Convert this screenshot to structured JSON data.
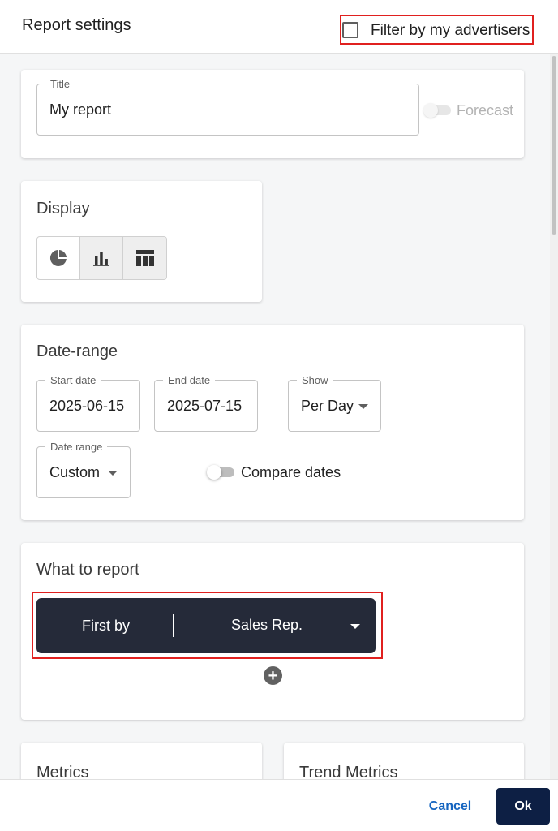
{
  "header": {
    "title": "Report settings",
    "filter_label": "Filter by my advertisers",
    "filter_checked": false
  },
  "title_card": {
    "title_label": "Title",
    "title_value": "My report",
    "forecast_label": "Forecast"
  },
  "display_card": {
    "heading": "Display",
    "options": [
      {
        "icon": "pie-chart-icon",
        "selected": false
      },
      {
        "icon": "bar-chart-icon",
        "selected": true
      },
      {
        "icon": "table-icon",
        "selected": true
      }
    ]
  },
  "date_card": {
    "heading": "Date-range",
    "start_label": "Start date",
    "start_value": "2025-06-15",
    "end_label": "End date",
    "end_value": "2025-07-15",
    "show_label": "Show",
    "show_value": "Per Day",
    "range_label": "Date range",
    "range_value": "Custom",
    "compare_label": "Compare dates"
  },
  "report_card": {
    "heading": "What to report",
    "first_by_label": "First by",
    "first_by_value": "Sales Rep."
  },
  "metrics_card": {
    "heading": "Metrics"
  },
  "trend_card": {
    "heading": "Trend Metrics"
  },
  "footer": {
    "cancel_label": "Cancel",
    "ok_label": "Ok"
  },
  "colors": {
    "accent_blue": "#1565c0",
    "dark_navy": "#252a39",
    "highlight_red": "#e0201f"
  }
}
